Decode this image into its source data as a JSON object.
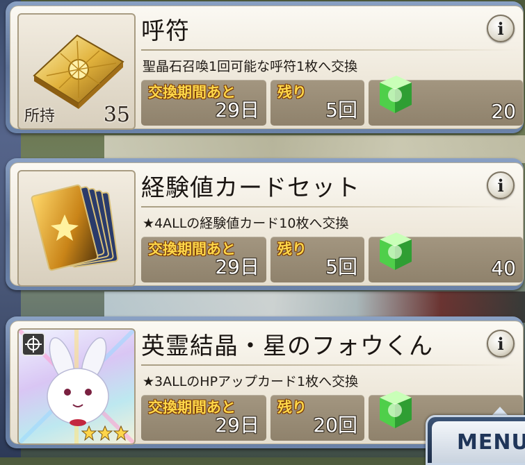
{
  "items": [
    {
      "name": "呼符",
      "description": "聖晶石召喚1回可能な呼符1枚へ交換",
      "owned_label": "所持",
      "owned_value": "35",
      "period_label": "交換期間あと",
      "period_value": "29日",
      "remaining_label": "残り",
      "remaining_value": "5回",
      "cost_value": "20",
      "thumbnail_icon": "summon-ticket-icon",
      "cost_icon": "green-cube-icon",
      "info_icon": "i"
    },
    {
      "name": "経験値カードセット",
      "description": "★4ALLの経験値カード10枚へ交換",
      "period_label": "交換期間あと",
      "period_value": "29日",
      "remaining_label": "残り",
      "remaining_value": "5回",
      "cost_value": "40",
      "thumbnail_icon": "exp-card-stack-icon",
      "cost_icon": "green-cube-icon",
      "info_icon": "i"
    },
    {
      "name": "英霊結晶・星のフォウくん",
      "description": "★3ALLのHPアップカード1枚へ交換",
      "period_label": "交換期間あと",
      "period_value": "29日",
      "remaining_label": "残り",
      "remaining_value": "20回",
      "thumbnail_icon": "fou-creature-icon",
      "cost_icon": "green-cube-icon",
      "info_icon": "i"
    }
  ],
  "menu": {
    "label": "MENU"
  },
  "colors": {
    "box_title": "#ffd84a",
    "cube": "#5fd95a",
    "card_border": "#6b83a9"
  }
}
